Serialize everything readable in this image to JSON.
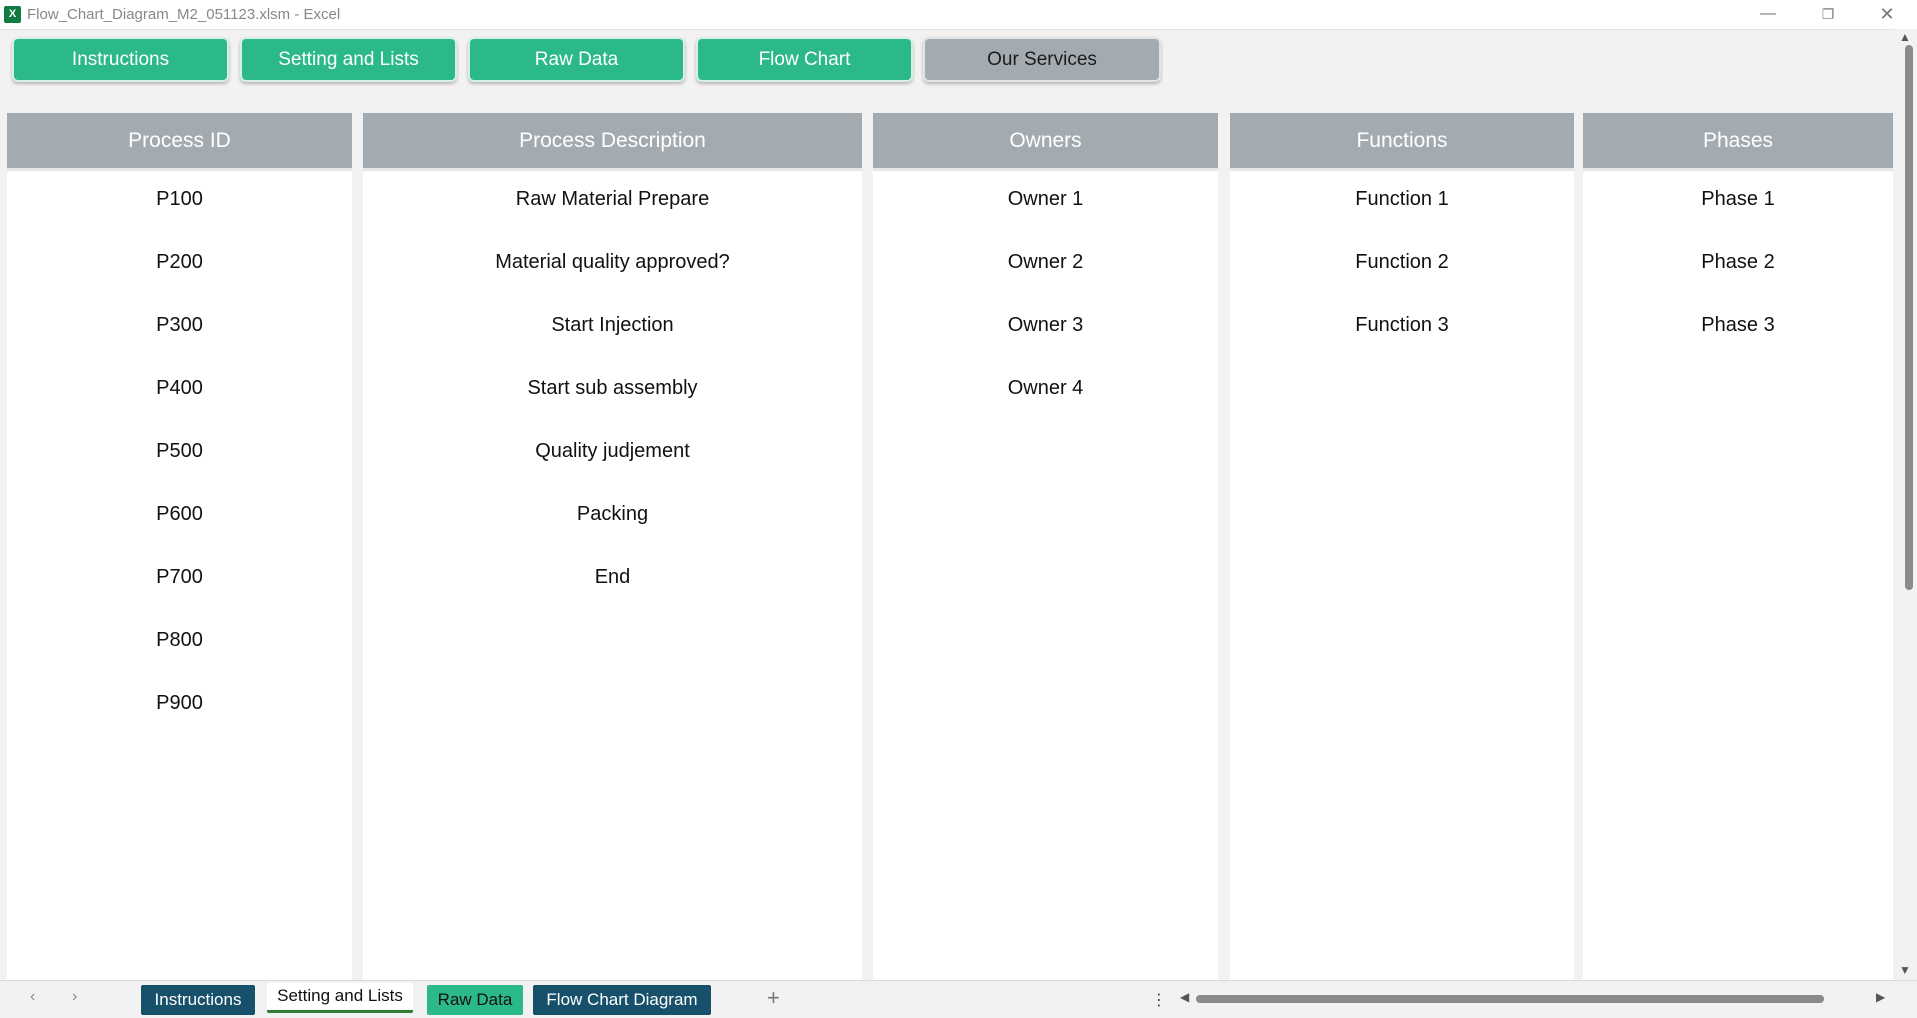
{
  "window": {
    "title": "Flow_Chart_Diagram_M2_051123.xlsm - Excel",
    "app_icon": "X"
  },
  "window_controls": {
    "minimize": "—",
    "restore": "❐",
    "close": "✕"
  },
  "nav": {
    "buttons": [
      {
        "label": "Instructions"
      },
      {
        "label": "Setting and Lists"
      },
      {
        "label": "Raw Data"
      },
      {
        "label": "Flow Chart"
      },
      {
        "label": "Our Services"
      }
    ]
  },
  "columns": {
    "process_id": {
      "header": "Process ID",
      "items": [
        "P100",
        "P200",
        "P300",
        "P400",
        "P500",
        "P600",
        "P700",
        "P800",
        "P900"
      ]
    },
    "process_description": {
      "header": "Process Description",
      "items": [
        "Raw Material Prepare",
        "Material quality approved?",
        "Start Injection",
        "Start sub assembly",
        "Quality judjement",
        "Packing",
        "End"
      ]
    },
    "owners": {
      "header": "Owners",
      "items": [
        "Owner 1",
        "Owner 2",
        "Owner 3",
        "Owner 4"
      ]
    },
    "functions": {
      "header": "Functions",
      "items": [
        "Function 1",
        "Function 2",
        "Function 3"
      ]
    },
    "phases": {
      "header": "Phases",
      "items": [
        "Phase 1",
        "Phase 2",
        "Phase 3"
      ]
    }
  },
  "sheet_tabs": {
    "prev": "‹",
    "next": "›",
    "tabs": [
      {
        "label": "Instructions"
      },
      {
        "label": "Setting and Lists"
      },
      {
        "label": "Raw Data"
      },
      {
        "label": "Flow Chart Diagram"
      }
    ],
    "add": "+",
    "more": "⋮"
  },
  "scroll_arrows": {
    "up": "▲",
    "down": "▼",
    "left": "◀",
    "right": "▶"
  },
  "colors": {
    "accent_green": "#2bb98a",
    "header_gray": "#a3abb1",
    "tab_dark": "#17506b"
  }
}
